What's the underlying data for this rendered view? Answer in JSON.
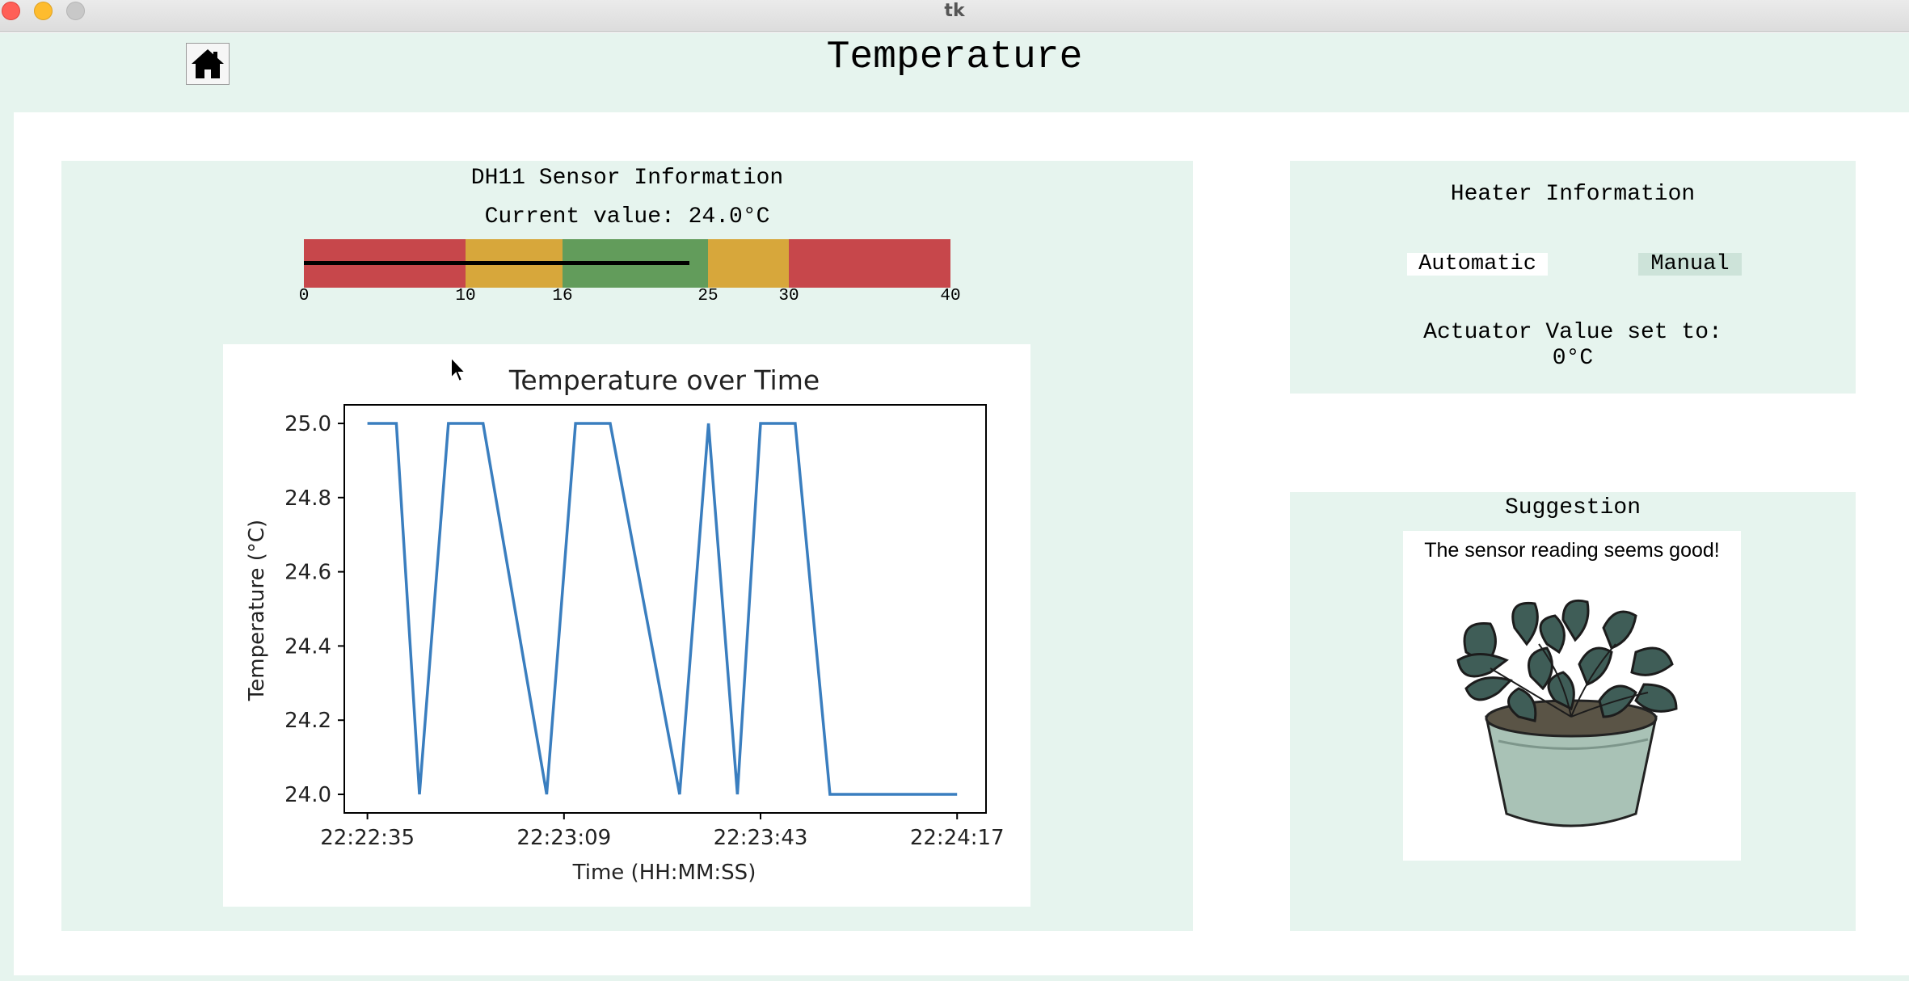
{
  "window": {
    "title": "tk"
  },
  "header": {
    "title": "Temperature",
    "home_icon": "home-icon"
  },
  "sensor": {
    "title": "DH11 Sensor Information",
    "current_value_text": "Current value: 24.0°C",
    "gauge": {
      "min": 0,
      "max": 40,
      "value": 24.0,
      "ticks": [
        "0",
        "10",
        "16",
        "25",
        "30",
        "40"
      ],
      "bands": [
        {
          "from": 0,
          "to": 10,
          "color": "#c7474b"
        },
        {
          "from": 10,
          "to": 16,
          "color": "#d7a73b"
        },
        {
          "from": 16,
          "to": 25,
          "color": "#629c5b"
        },
        {
          "from": 25,
          "to": 30,
          "color": "#d7a73b"
        },
        {
          "from": 30,
          "to": 40,
          "color": "#c7474b"
        }
      ]
    }
  },
  "chart_data": {
    "type": "line",
    "title": "Temperature over Time",
    "xlabel": "Time (HH:MM:SS)",
    "ylabel": "Temperature (°C)",
    "x_ticks": [
      "22:22:35",
      "22:23:09",
      "22:23:43",
      "22:24:17"
    ],
    "y_ticks": [
      "24.0",
      "24.2",
      "24.4",
      "24.6",
      "24.8",
      "25.0"
    ],
    "xlim": [
      "22:22:31",
      "22:24:22"
    ],
    "ylim": [
      23.95,
      25.05
    ],
    "grid": false,
    "color": "#3a7ebf",
    "series": [
      {
        "x": [
          "22:22:35",
          "22:22:40",
          "22:22:44",
          "22:22:49",
          "22:22:55",
          "22:23:06",
          "22:23:11",
          "22:23:17",
          "22:23:29",
          "22:23:34",
          "22:23:39",
          "22:23:43",
          "22:23:49",
          "22:23:55",
          "22:24:17"
        ],
        "values": [
          25.0,
          25.0,
          24.0,
          25.0,
          25.0,
          24.0,
          25.0,
          25.0,
          24.0,
          25.0,
          24.0,
          25.0,
          25.0,
          24.0,
          24.0
        ]
      }
    ]
  },
  "heater": {
    "title": "Heater Information",
    "automatic_label": "Automatic",
    "manual_label": "Manual",
    "actuator_label": "Actuator Value set to:",
    "actuator_value": "0°C"
  },
  "suggestion": {
    "title": "Suggestion",
    "text": "The sensor reading seems good!",
    "image_icon": "potted-plant-icon"
  }
}
